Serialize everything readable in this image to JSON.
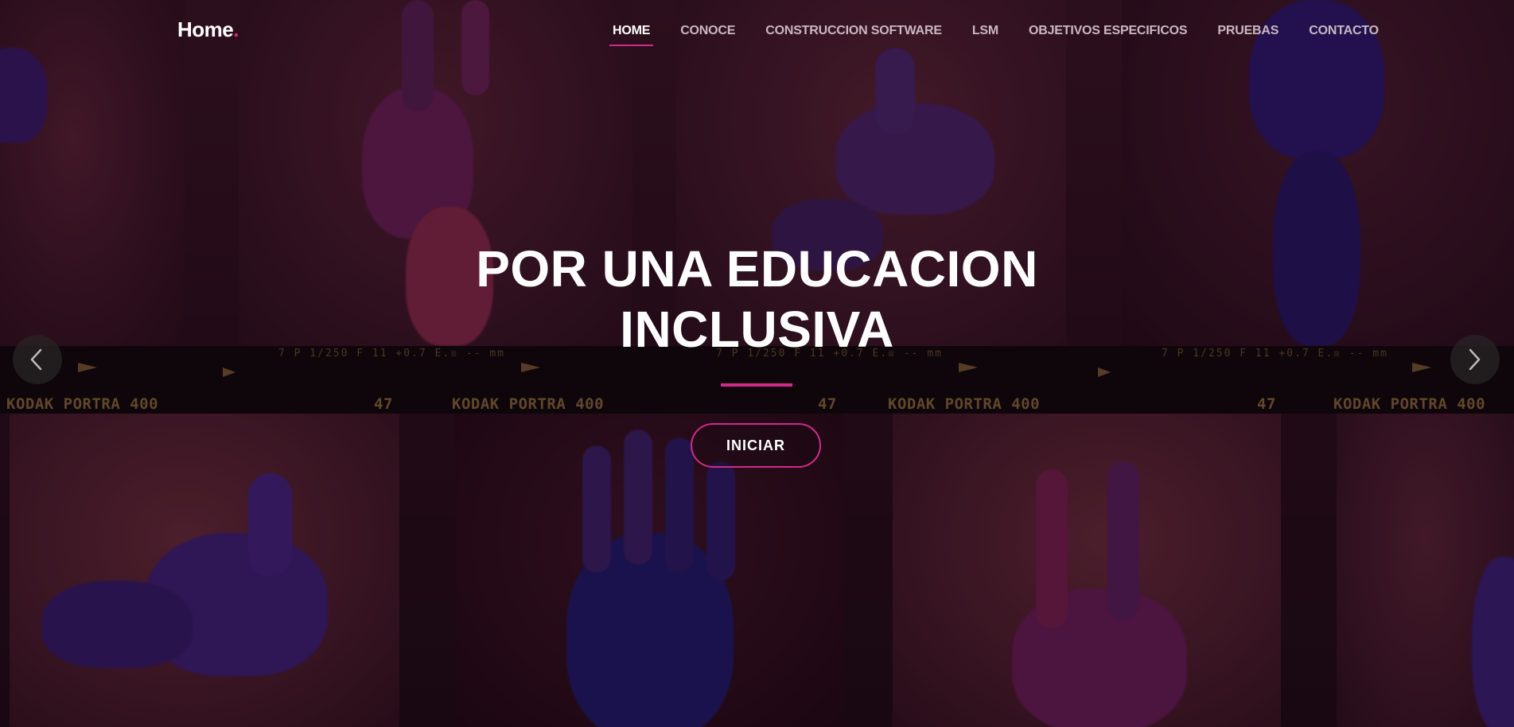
{
  "nav": {
    "brand": "Home",
    "brand_dot": ".",
    "items": [
      {
        "label": "HOME",
        "active": true
      },
      {
        "label": "CONOCE",
        "active": false
      },
      {
        "label": "CONSTRUCCION SOFTWARE",
        "active": false
      },
      {
        "label": "LSM",
        "active": false
      },
      {
        "label": "OBJETIVOS ESPECIFICOS",
        "active": false
      },
      {
        "label": "PRUEBAS",
        "active": false
      },
      {
        "label": "CONTACTO",
        "active": false
      }
    ]
  },
  "hero": {
    "title_line1": "POR UNA EDUCACION",
    "title_line2": "INCLUSIVA",
    "cta_label": "INICIAR",
    "background_film_text": {
      "brand": "KODAK  PORTRA 400",
      "frame_number": "47",
      "exposure": "7 P  1/250  F 11   +0.7 E.☒   -- mm"
    }
  },
  "carousel": {
    "prev_icon": "chevron-left-icon",
    "next_icon": "chevron-right-icon"
  },
  "colors": {
    "accent": "#d02a8a",
    "text": "#ffffff",
    "nav_text": "#c9b8c1"
  }
}
